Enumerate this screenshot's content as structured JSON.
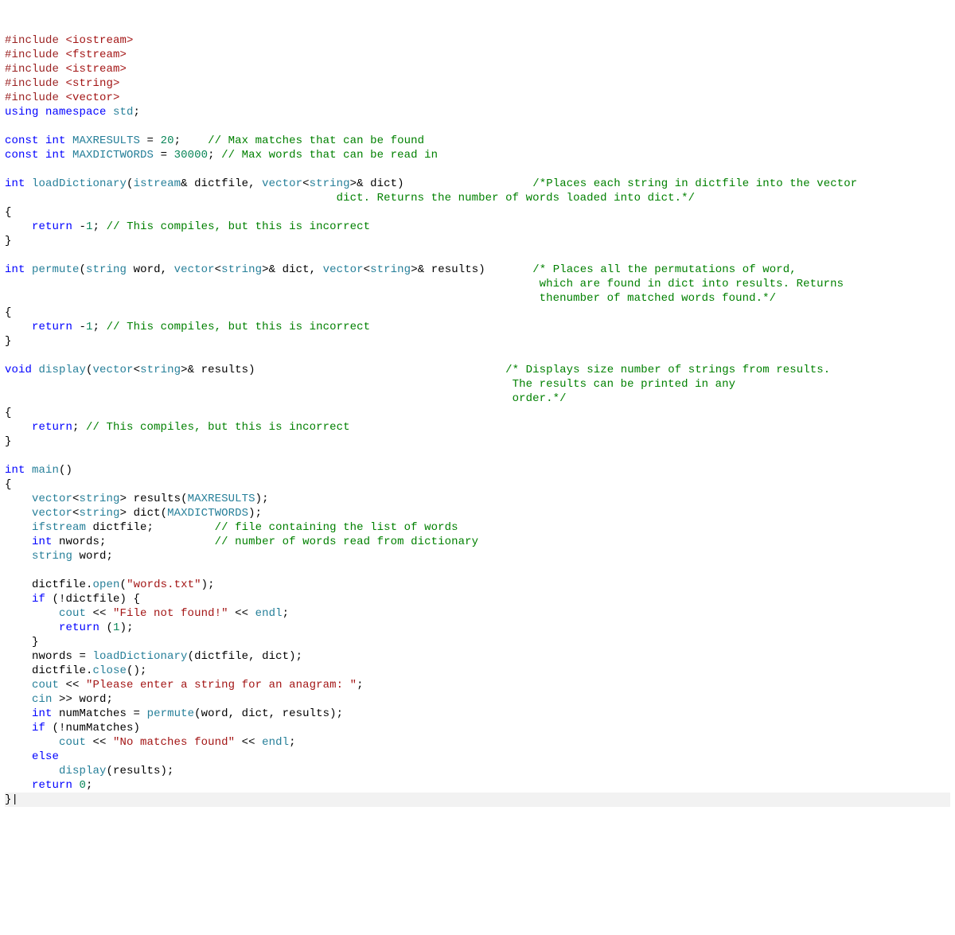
{
  "lines": [
    [
      {
        "c": "pp",
        "t": "#include "
      },
      {
        "c": "inc",
        "t": "<iostream>"
      }
    ],
    [
      {
        "c": "pp",
        "t": "#include "
      },
      {
        "c": "inc",
        "t": "<fstream>"
      }
    ],
    [
      {
        "c": "pp",
        "t": "#include "
      },
      {
        "c": "inc",
        "t": "<istream>"
      }
    ],
    [
      {
        "c": "pp",
        "t": "#include "
      },
      {
        "c": "inc",
        "t": "<string>"
      }
    ],
    [
      {
        "c": "pp",
        "t": "#include "
      },
      {
        "c": "inc",
        "t": "<vector>"
      }
    ],
    [
      {
        "c": "kw",
        "t": "using "
      },
      {
        "c": "kw",
        "t": "namespace "
      },
      {
        "c": "type",
        "t": "std"
      },
      {
        "c": "op",
        "t": ";"
      }
    ],
    [],
    [
      {
        "c": "kw",
        "t": "const "
      },
      {
        "c": "kw",
        "t": "int "
      },
      {
        "c": "id",
        "t": "MAXRESULTS"
      },
      {
        "c": "op",
        "t": " = "
      },
      {
        "c": "num",
        "t": "20"
      },
      {
        "c": "op",
        "t": ";    "
      },
      {
        "c": "com",
        "t": "// Max matches that can be found"
      }
    ],
    [
      {
        "c": "kw",
        "t": "const "
      },
      {
        "c": "kw",
        "t": "int "
      },
      {
        "c": "id",
        "t": "MAXDICTWORDS"
      },
      {
        "c": "op",
        "t": " = "
      },
      {
        "c": "num",
        "t": "30000"
      },
      {
        "c": "op",
        "t": "; "
      },
      {
        "c": "com",
        "t": "// Max words that can be read in"
      }
    ],
    [],
    [
      {
        "c": "kw",
        "t": "int "
      },
      {
        "c": "id",
        "t": "loadDictionary"
      },
      {
        "c": "op",
        "t": "("
      },
      {
        "c": "type",
        "t": "istream"
      },
      {
        "c": "op",
        "t": "& dictfile, "
      },
      {
        "c": "type",
        "t": "vector"
      },
      {
        "c": "op",
        "t": "<"
      },
      {
        "c": "type",
        "t": "string"
      },
      {
        "c": "op",
        "t": ">& dict)                   "
      },
      {
        "c": "com",
        "t": "/*Places each string in dictfile into the vector"
      }
    ],
    [
      {
        "c": "op",
        "t": "                                                 "
      },
      {
        "c": "com",
        "t": "dict. Returns the number of words loaded into dict.*/"
      }
    ],
    [
      {
        "c": "op",
        "t": "{"
      }
    ],
    [
      {
        "c": "op",
        "t": "    "
      },
      {
        "c": "kw",
        "t": "return "
      },
      {
        "c": "op",
        "t": "-"
      },
      {
        "c": "num",
        "t": "1"
      },
      {
        "c": "op",
        "t": "; "
      },
      {
        "c": "com",
        "t": "// This compiles, but this is incorrect"
      }
    ],
    [
      {
        "c": "op",
        "t": "}"
      }
    ],
    [],
    [
      {
        "c": "kw",
        "t": "int "
      },
      {
        "c": "id",
        "t": "permute"
      },
      {
        "c": "op",
        "t": "("
      },
      {
        "c": "type",
        "t": "string"
      },
      {
        "c": "op",
        "t": " word, "
      },
      {
        "c": "type",
        "t": "vector"
      },
      {
        "c": "op",
        "t": "<"
      },
      {
        "c": "type",
        "t": "string"
      },
      {
        "c": "op",
        "t": ">& dict, "
      },
      {
        "c": "type",
        "t": "vector"
      },
      {
        "c": "op",
        "t": "<"
      },
      {
        "c": "type",
        "t": "string"
      },
      {
        "c": "op",
        "t": ">& results)       "
      },
      {
        "c": "com",
        "t": "/* Places all the permutations of word,"
      }
    ],
    [
      {
        "c": "op",
        "t": "                                                                               "
      },
      {
        "c": "com",
        "t": "which are found in dict into results. Returns"
      }
    ],
    [
      {
        "c": "op",
        "t": "                                                                               "
      },
      {
        "c": "com",
        "t": "thenumber of matched words found.*/"
      }
    ],
    [
      {
        "c": "op",
        "t": "{"
      }
    ],
    [
      {
        "c": "op",
        "t": "    "
      },
      {
        "c": "kw",
        "t": "return "
      },
      {
        "c": "op",
        "t": "-"
      },
      {
        "c": "num",
        "t": "1"
      },
      {
        "c": "op",
        "t": "; "
      },
      {
        "c": "com",
        "t": "// This compiles, but this is incorrect"
      }
    ],
    [
      {
        "c": "op",
        "t": "}"
      }
    ],
    [],
    [
      {
        "c": "kw",
        "t": "void "
      },
      {
        "c": "id",
        "t": "display"
      },
      {
        "c": "op",
        "t": "("
      },
      {
        "c": "type",
        "t": "vector"
      },
      {
        "c": "op",
        "t": "<"
      },
      {
        "c": "type",
        "t": "string"
      },
      {
        "c": "op",
        "t": ">& results)                                     "
      },
      {
        "c": "com",
        "t": "/* Displays size number of strings from results."
      }
    ],
    [
      {
        "c": "op",
        "t": "                                                                           "
      },
      {
        "c": "com",
        "t": "The results can be printed in any"
      }
    ],
    [
      {
        "c": "op",
        "t": "                                                                           "
      },
      {
        "c": "com",
        "t": "order.*/"
      }
    ],
    [
      {
        "c": "op",
        "t": "{"
      }
    ],
    [
      {
        "c": "op",
        "t": "    "
      },
      {
        "c": "kw",
        "t": "return"
      },
      {
        "c": "op",
        "t": "; "
      },
      {
        "c": "com",
        "t": "// This compiles, but this is incorrect"
      }
    ],
    [
      {
        "c": "op",
        "t": "}"
      }
    ],
    [],
    [
      {
        "c": "kw",
        "t": "int "
      },
      {
        "c": "id",
        "t": "main"
      },
      {
        "c": "op",
        "t": "()"
      }
    ],
    [
      {
        "c": "op",
        "t": "{"
      }
    ],
    [
      {
        "c": "op",
        "t": "    "
      },
      {
        "c": "type",
        "t": "vector"
      },
      {
        "c": "op",
        "t": "<"
      },
      {
        "c": "type",
        "t": "string"
      },
      {
        "c": "op",
        "t": "> results("
      },
      {
        "c": "id",
        "t": "MAXRESULTS"
      },
      {
        "c": "op",
        "t": ");"
      }
    ],
    [
      {
        "c": "op",
        "t": "    "
      },
      {
        "c": "type",
        "t": "vector"
      },
      {
        "c": "op",
        "t": "<"
      },
      {
        "c": "type",
        "t": "string"
      },
      {
        "c": "op",
        "t": "> dict("
      },
      {
        "c": "id",
        "t": "MAXDICTWORDS"
      },
      {
        "c": "op",
        "t": ");"
      }
    ],
    [
      {
        "c": "op",
        "t": "    "
      },
      {
        "c": "type",
        "t": "ifstream"
      },
      {
        "c": "op",
        "t": " dictfile;         "
      },
      {
        "c": "com",
        "t": "// file containing the list of words"
      }
    ],
    [
      {
        "c": "op",
        "t": "    "
      },
      {
        "c": "kw",
        "t": "int "
      },
      {
        "c": "op",
        "t": "nwords;                "
      },
      {
        "c": "com",
        "t": "// number of words read from dictionary"
      }
    ],
    [
      {
        "c": "op",
        "t": "    "
      },
      {
        "c": "type",
        "t": "string"
      },
      {
        "c": "op",
        "t": " word;"
      }
    ],
    [],
    [
      {
        "c": "op",
        "t": "    dictfile."
      },
      {
        "c": "id",
        "t": "open"
      },
      {
        "c": "op",
        "t": "("
      },
      {
        "c": "str",
        "t": "\"words.txt\""
      },
      {
        "c": "op",
        "t": ");"
      }
    ],
    [
      {
        "c": "op",
        "t": "    "
      },
      {
        "c": "kw",
        "t": "if"
      },
      {
        "c": "op",
        "t": " (!dictfile) {"
      }
    ],
    [
      {
        "c": "op",
        "t": "        "
      },
      {
        "c": "id",
        "t": "cout"
      },
      {
        "c": "op",
        "t": " << "
      },
      {
        "c": "str",
        "t": "\"File not found!\""
      },
      {
        "c": "op",
        "t": " << "
      },
      {
        "c": "id",
        "t": "endl"
      },
      {
        "c": "op",
        "t": ";"
      }
    ],
    [
      {
        "c": "op",
        "t": "        "
      },
      {
        "c": "kw",
        "t": "return "
      },
      {
        "c": "op",
        "t": "("
      },
      {
        "c": "num",
        "t": "1"
      },
      {
        "c": "op",
        "t": ");"
      }
    ],
    [
      {
        "c": "op",
        "t": "    }"
      }
    ],
    [
      {
        "c": "op",
        "t": "    nwords = "
      },
      {
        "c": "id",
        "t": "loadDictionary"
      },
      {
        "c": "op",
        "t": "(dictfile, dict);"
      }
    ],
    [
      {
        "c": "op",
        "t": "    dictfile."
      },
      {
        "c": "id",
        "t": "close"
      },
      {
        "c": "op",
        "t": "();"
      }
    ],
    [
      {
        "c": "op",
        "t": "    "
      },
      {
        "c": "id",
        "t": "cout"
      },
      {
        "c": "op",
        "t": " << "
      },
      {
        "c": "str",
        "t": "\"Please enter a string for an anagram: \""
      },
      {
        "c": "op",
        "t": ";"
      }
    ],
    [
      {
        "c": "op",
        "t": "    "
      },
      {
        "c": "id",
        "t": "cin"
      },
      {
        "c": "op",
        "t": " >> word;"
      }
    ],
    [
      {
        "c": "op",
        "t": "    "
      },
      {
        "c": "kw",
        "t": "int "
      },
      {
        "c": "op",
        "t": "numMatches = "
      },
      {
        "c": "id",
        "t": "permute"
      },
      {
        "c": "op",
        "t": "(word, dict, results);"
      }
    ],
    [
      {
        "c": "op",
        "t": "    "
      },
      {
        "c": "kw",
        "t": "if"
      },
      {
        "c": "op",
        "t": " (!numMatches)"
      }
    ],
    [
      {
        "c": "op",
        "t": "        "
      },
      {
        "c": "id",
        "t": "cout"
      },
      {
        "c": "op",
        "t": " << "
      },
      {
        "c": "str",
        "t": "\"No matches found\""
      },
      {
        "c": "op",
        "t": " << "
      },
      {
        "c": "id",
        "t": "endl"
      },
      {
        "c": "op",
        "t": ";"
      }
    ],
    [
      {
        "c": "op",
        "t": "    "
      },
      {
        "c": "kw",
        "t": "else"
      }
    ],
    [
      {
        "c": "op",
        "t": "        "
      },
      {
        "c": "id",
        "t": "display"
      },
      {
        "c": "op",
        "t": "(results);"
      }
    ],
    [
      {
        "c": "op",
        "t": "    "
      },
      {
        "c": "kw",
        "t": "return "
      },
      {
        "c": "num",
        "t": "0"
      },
      {
        "c": "op",
        "t": ";"
      }
    ],
    [
      {
        "c": "op",
        "t": "}|",
        "last": true
      }
    ]
  ]
}
